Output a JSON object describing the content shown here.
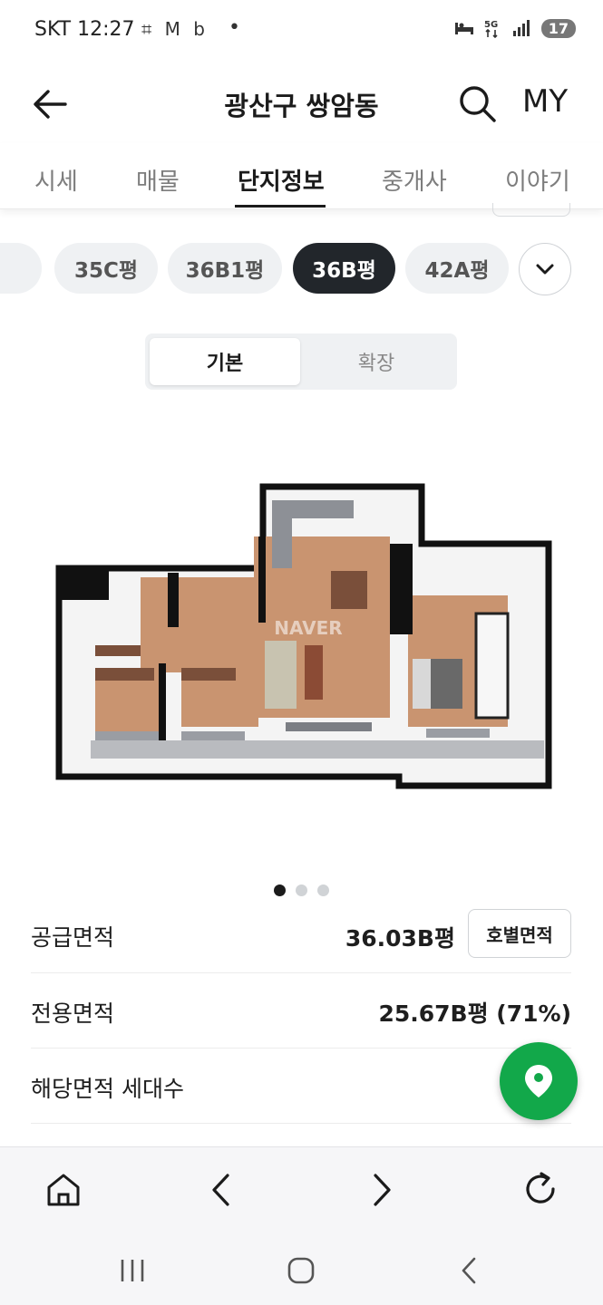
{
  "status_bar": {
    "carrier_time": "SKT 12:27",
    "left_icons": "⌗ M b",
    "dot": "•",
    "battery": "17",
    "icon_names": [
      "scan-icon",
      "gmail-icon",
      "blog-icon",
      "hotel-bed-icon",
      "5g-icon",
      "signal-icon",
      "battery-icon"
    ]
  },
  "header": {
    "title": "광산구 쌍암동",
    "my_label": "MY",
    "icon_names": [
      "back-arrow-icon",
      "search-icon"
    ]
  },
  "tabs": [
    {
      "label": "시세"
    },
    {
      "label": "매물"
    },
    {
      "label": "단지정보",
      "active": true
    },
    {
      "label": "중개사"
    },
    {
      "label": "이야기"
    }
  ],
  "size_chips": [
    {
      "label": "35C평"
    },
    {
      "label": "36B1평"
    },
    {
      "label": "36B평",
      "active": true
    },
    {
      "label": "42A평"
    }
  ],
  "segmented": {
    "basic": "기본",
    "extended": "확장",
    "selected": "기본"
  },
  "floorplan": {
    "watermark": "NAVER",
    "carousel_index": 1,
    "carousel_total": 3
  },
  "info": {
    "supply_area_label": "공급면적",
    "supply_area_value": "36.03B평",
    "unit_area_button": "호별면적",
    "exclusive_area_label": "전용면적",
    "exclusive_area_value": "25.67B평 (71%)",
    "households_label": "해당면적 세대수"
  },
  "accent_colors": {
    "fab": "#12a84a",
    "active_chip": "#22262b"
  },
  "browser_bar_icons": [
    "home-icon",
    "back-chevron-icon",
    "forward-chevron-icon",
    "refresh-icon"
  ],
  "system_nav_icons": [
    "recent-apps-icon",
    "home-circle-icon",
    "system-back-icon"
  ]
}
